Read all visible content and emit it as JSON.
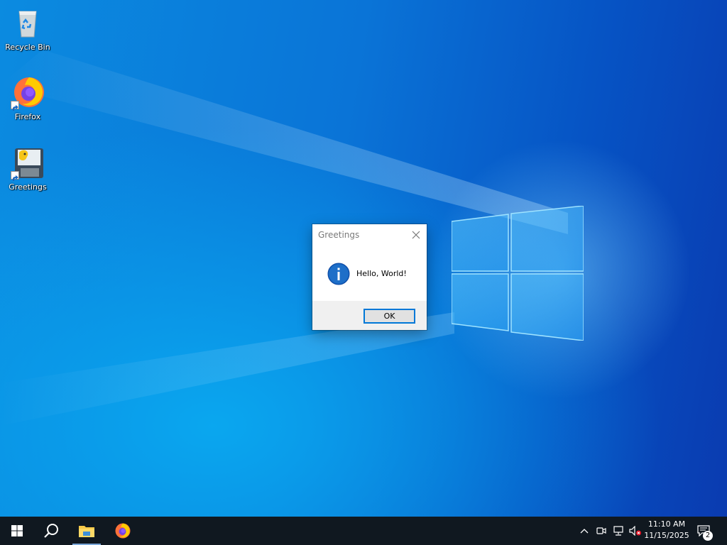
{
  "desktop": {
    "icons": [
      {
        "label": "Recycle Bin",
        "icon": "recycle-bin-icon"
      },
      {
        "label": "Firefox",
        "icon": "firefox-icon"
      },
      {
        "label": "Greetings",
        "icon": "greetings-app-icon"
      }
    ]
  },
  "dialog": {
    "title": "Greetings",
    "message": "Hello, World!",
    "ok_label": "OK",
    "icon": "info-icon",
    "close_icon": "close-icon"
  },
  "taskbar": {
    "start_icon": "windows-start-icon",
    "search_icon": "search-icon",
    "pinned": [
      {
        "icon": "file-explorer-icon"
      },
      {
        "icon": "firefox-icon"
      }
    ],
    "tray": {
      "icons": [
        "chevron-up-icon",
        "meet-now-icon",
        "network-icon",
        "volume-muted-icon"
      ],
      "time": "11:10 AM",
      "date": "11/15/2025",
      "notification_count": "2"
    }
  },
  "colors": {
    "accent": "#0078d7",
    "taskbar": "#101820",
    "desktop_blue": "#0a74d7"
  }
}
